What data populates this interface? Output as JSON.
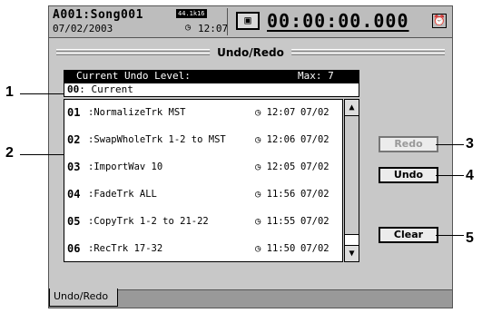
{
  "header": {
    "song": "A001:Song001",
    "format_badge": "44.1k16",
    "date": "07/02/2003",
    "time": "12:07",
    "counter": "00:00:00.000",
    "meter_icon": "meter-icon",
    "alarm_icon": "clock-icon"
  },
  "title": "Undo/Redo",
  "list": {
    "header_label": "Current Undo Level:",
    "max_label": "Max:  7",
    "current": {
      "number": "00",
      "name": ": Current"
    },
    "items": [
      {
        "number": "01",
        "name": ":NormalizeTrk MST",
        "time": "12:07",
        "date": "07/02"
      },
      {
        "number": "02",
        "name": ":SwapWholeTrk 1-2 to MST",
        "time": "12:06",
        "date": "07/02"
      },
      {
        "number": "03",
        "name": ":ImportWav 10",
        "time": "12:05",
        "date": "07/02"
      },
      {
        "number": "04",
        "name": ":FadeTrk ALL",
        "time": "11:56",
        "date": "07/02"
      },
      {
        "number": "05",
        "name": ":CopyTrk 1-2 to 21-22",
        "time": "11:55",
        "date": "07/02"
      },
      {
        "number": "06",
        "name": ":RecTrk 17-32",
        "time": "11:50",
        "date": "07/02"
      }
    ]
  },
  "buttons": {
    "redo": "Redo",
    "undo": "Undo",
    "clear": "Clear"
  },
  "tab": "Undo/Redo",
  "callouts": [
    "1",
    "2",
    "3",
    "4",
    "5"
  ]
}
